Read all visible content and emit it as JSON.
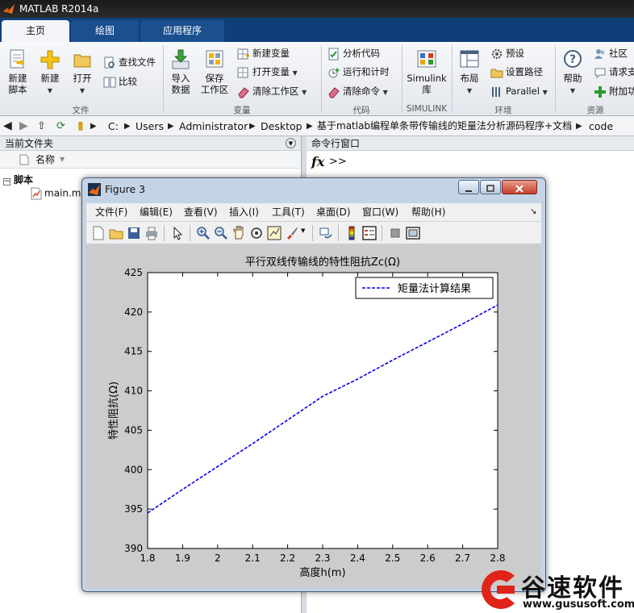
{
  "window": {
    "title": "MATLAB R2014a"
  },
  "tabs": [
    {
      "label": "主页",
      "active": true
    },
    {
      "label": "绘图",
      "active": false
    },
    {
      "label": "应用程序",
      "active": false
    }
  ],
  "ribbon": {
    "file": {
      "new_script_l1": "新建",
      "new_script_l2": "脚本",
      "new": "新建",
      "open": "打开",
      "find_files": "查找文件",
      "compare": "比较",
      "group": "文件"
    },
    "variable": {
      "import_l1": "导入",
      "import_l2": "数据",
      "save_l1": "保存",
      "save_l2": "工作区",
      "new_var": "新建变量",
      "open_var": "打开变量",
      "clear_ws": "清除工作区",
      "group": "变量"
    },
    "code": {
      "analyze": "分析代码",
      "run_time": "运行和计时",
      "clear_cmd": "清除命令",
      "group": "代码"
    },
    "simulink": {
      "label_l1": "Simulink",
      "label_l2": "库",
      "group": "SIMULINK"
    },
    "env": {
      "layout": "布局",
      "prefs": "预设",
      "set_path": "设置路径",
      "parallel": "Parallel",
      "group": "环境"
    },
    "resources": {
      "help": "帮助",
      "community": "社区",
      "request": "请求支",
      "addons": "附加功",
      "group": "资源"
    }
  },
  "address": {
    "parts": [
      "C:",
      "Users",
      "Administrator",
      "Desktop",
      "基于matlab编程单条带传输线的矩量法分析源码程序+文档",
      "code"
    ]
  },
  "left_panel": {
    "title": "当前文件夹",
    "column_name": "名称",
    "group": "脚本",
    "file": "main.m"
  },
  "right_panel": {
    "title": "命令行窗口",
    "fx": "fx",
    "prompt": ">>"
  },
  "figure": {
    "title": "Figure 3",
    "menu": [
      "文件(F)",
      "编辑(E)",
      "查看(V)",
      "插入(I)",
      "工具(T)",
      "桌面(D)",
      "窗口(W)",
      "帮助(H)"
    ]
  },
  "chart_data": {
    "type": "line",
    "title": "平行双线传输线的特性阻抗Zc(Ω)",
    "xlabel": "高度h(m)",
    "ylabel": "特性阻抗(Ω)",
    "xlim": [
      1.8,
      2.8
    ],
    "ylim": [
      390,
      425
    ],
    "xticks": [
      "1.8",
      "1.9",
      "2",
      "2.1",
      "2.2",
      "2.3",
      "2.4",
      "2.5",
      "2.6",
      "2.7",
      "2.8"
    ],
    "yticks": [
      "390",
      "395",
      "400",
      "405",
      "410",
      "415",
      "420",
      "425"
    ],
    "legend_position": "top-right",
    "grid": false,
    "series": [
      {
        "name": "矩量法计算结果",
        "color": "#0000ee",
        "line_style": "dashed",
        "x": [
          1.8,
          1.9,
          2.0,
          2.1,
          2.2,
          2.3,
          2.4,
          2.5,
          2.6,
          2.7,
          2.8
        ],
        "y": [
          394.5,
          397.5,
          400.4,
          403.3,
          406.3,
          409.3,
          411.5,
          413.9,
          416.2,
          418.5,
          420.9
        ]
      }
    ]
  },
  "watermark": {
    "name": "谷速软件",
    "url": "www.gususoft.com",
    "color": "#e0241a"
  }
}
